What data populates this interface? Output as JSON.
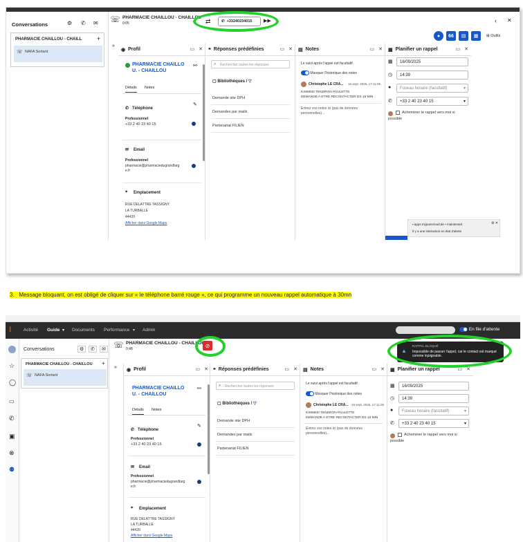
{
  "caption": "3.   Message bloquant, on est obligé de cliquer sur « le téléphone barré rouge », ce qui programme un nouveau rappel automatique à 30mn",
  "colors": {
    "accent": "#1857c9",
    "green": "#22d12a",
    "red": "#e02b2b",
    "highlight": "#ffff00"
  },
  "shot1": {
    "conversations_title": "Conversations",
    "conv_item_title": "PHARMACIE CHAILLOU - CHAILL",
    "conv_sub_item": "NAFA Sortant",
    "call_title": "PHARMACIE CHAILLOU - CHAILLOU",
    "call_timer": "0:05",
    "phone_number": "+33240234015",
    "tools_label": "Outils",
    "badge_66": "66"
  },
  "shot2": {
    "nav": [
      "Activité",
      "Guide",
      "Documents",
      "Performance",
      "Admin"
    ],
    "queue_label": "En file d'attente",
    "conversations_title": "Conversations",
    "conv_item_title": "PHARMACIE CHAILLOU - CHAILLOU",
    "conv_sub_item": "NAFA Sortant",
    "call_title": "PHARMACIE CHAILLOU - CHAILLOU",
    "call_timer": "0:48",
    "alert_title": "RAPPEL BLOQUÉ",
    "alert_text": "Impossible de passer l'appel, car le contact est marqué comme injoignable."
  },
  "profile": {
    "title": "Profil",
    "name_line1": "PHARMACIE CHAILLO",
    "name_line2": "U. - CHAILLOU",
    "tab_details": "Détails",
    "tab_notes": "Notes",
    "phone_section": "Téléphone",
    "phone_kind": "Professionnel",
    "phone_value": "+33 2 40 23 40 15",
    "email_section": "Email",
    "email_kind": "Professionnel",
    "email_value_1": "pharmacie@pharmaciedugrandlarg",
    "email_value_2": "e.fr",
    "location_section": "Emplacement",
    "address_1": "RUE DELATTRE TASSIGNY",
    "address_2": "LA TURBALLE",
    "address_3": "44420",
    "maps_link": "Afficher dans Google Maps"
  },
  "responses": {
    "title": "Réponses prédéfinies",
    "search_placeholder": "Rechercher toutes les réponses",
    "libraries": "Bibliothèques",
    "items": [
      "Demande site DPH",
      "Demandes par mails",
      "Partenariat FILIEN"
    ]
  },
  "notes": {
    "title": "Notes",
    "optional_text": "Le suivi après l'appel est facultatif.",
    "hide_history": "Masquer l'historique des notes",
    "author": "Christophe LE CRA...",
    "date": "15 sept. 2025, 17:11:05",
    "note_line1": "KS86830 TENDRON PAULETTE",
    "note_line2": "DEMANDE A ETRE RECONTACTER DS 15 MIN",
    "input_placeholder_1": "Entrez vos notes ici (pas de données",
    "input_placeholder_2": "personnelles)..."
  },
  "callback": {
    "title": "Planifier un rappel",
    "date": "16/09/2025",
    "time": "14:39",
    "timezone": "Fuseau horaire (facultatif)",
    "phone": "+33 2 40 23 40 15",
    "route_to_me_1": "Acheminer le rappel vers moi si",
    "route_to_me_2": "possible"
  },
  "toast1": {
    "source": "apps.mypurecloud.de",
    "status": "maintenant",
    "text": "Il y a une interaction en état d'alerte"
  }
}
